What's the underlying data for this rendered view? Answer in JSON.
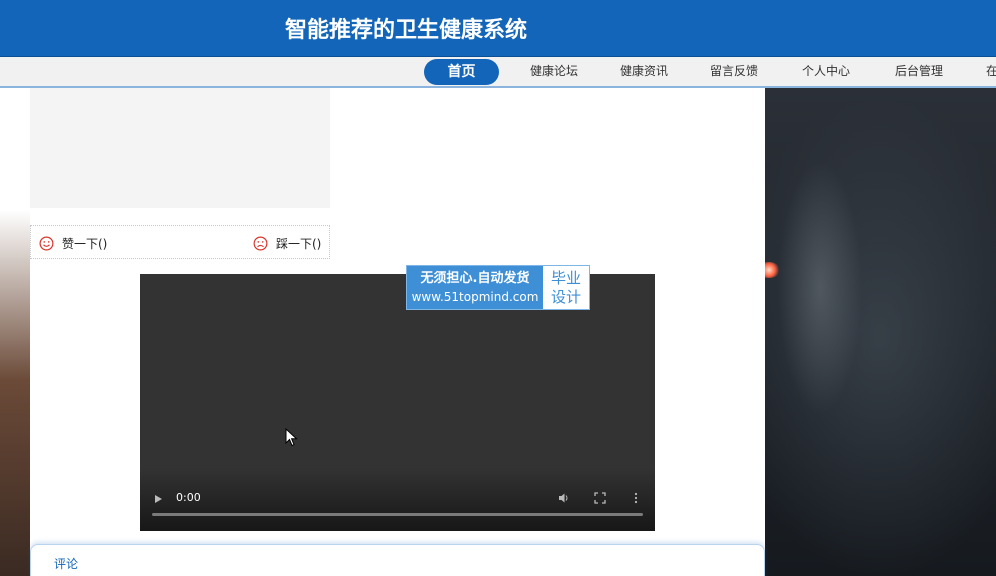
{
  "header": {
    "title": "智能推荐的卫生健康系统"
  },
  "nav": {
    "items": [
      {
        "label": "首页",
        "active": true
      },
      {
        "label": "健康论坛",
        "active": false
      },
      {
        "label": "健康资讯",
        "active": false
      },
      {
        "label": "留言反馈",
        "active": false
      },
      {
        "label": "个人中心",
        "active": false
      },
      {
        "label": "后台管理",
        "active": false
      },
      {
        "label": "在",
        "active": false
      }
    ]
  },
  "votes": {
    "like_label": "赞一下()",
    "dislike_label": "踩一下()"
  },
  "video": {
    "time": "0:00"
  },
  "watermark": {
    "line1": "无须担心.自动发货",
    "line2": "www.51topmind.com",
    "badge_line1": "毕业",
    "badge_line2": "设计"
  },
  "comments": {
    "label": "评论"
  },
  "colors": {
    "brand": "#1265b8",
    "vote_icon": "#d9342b",
    "watermark": "#3e8fd6"
  }
}
